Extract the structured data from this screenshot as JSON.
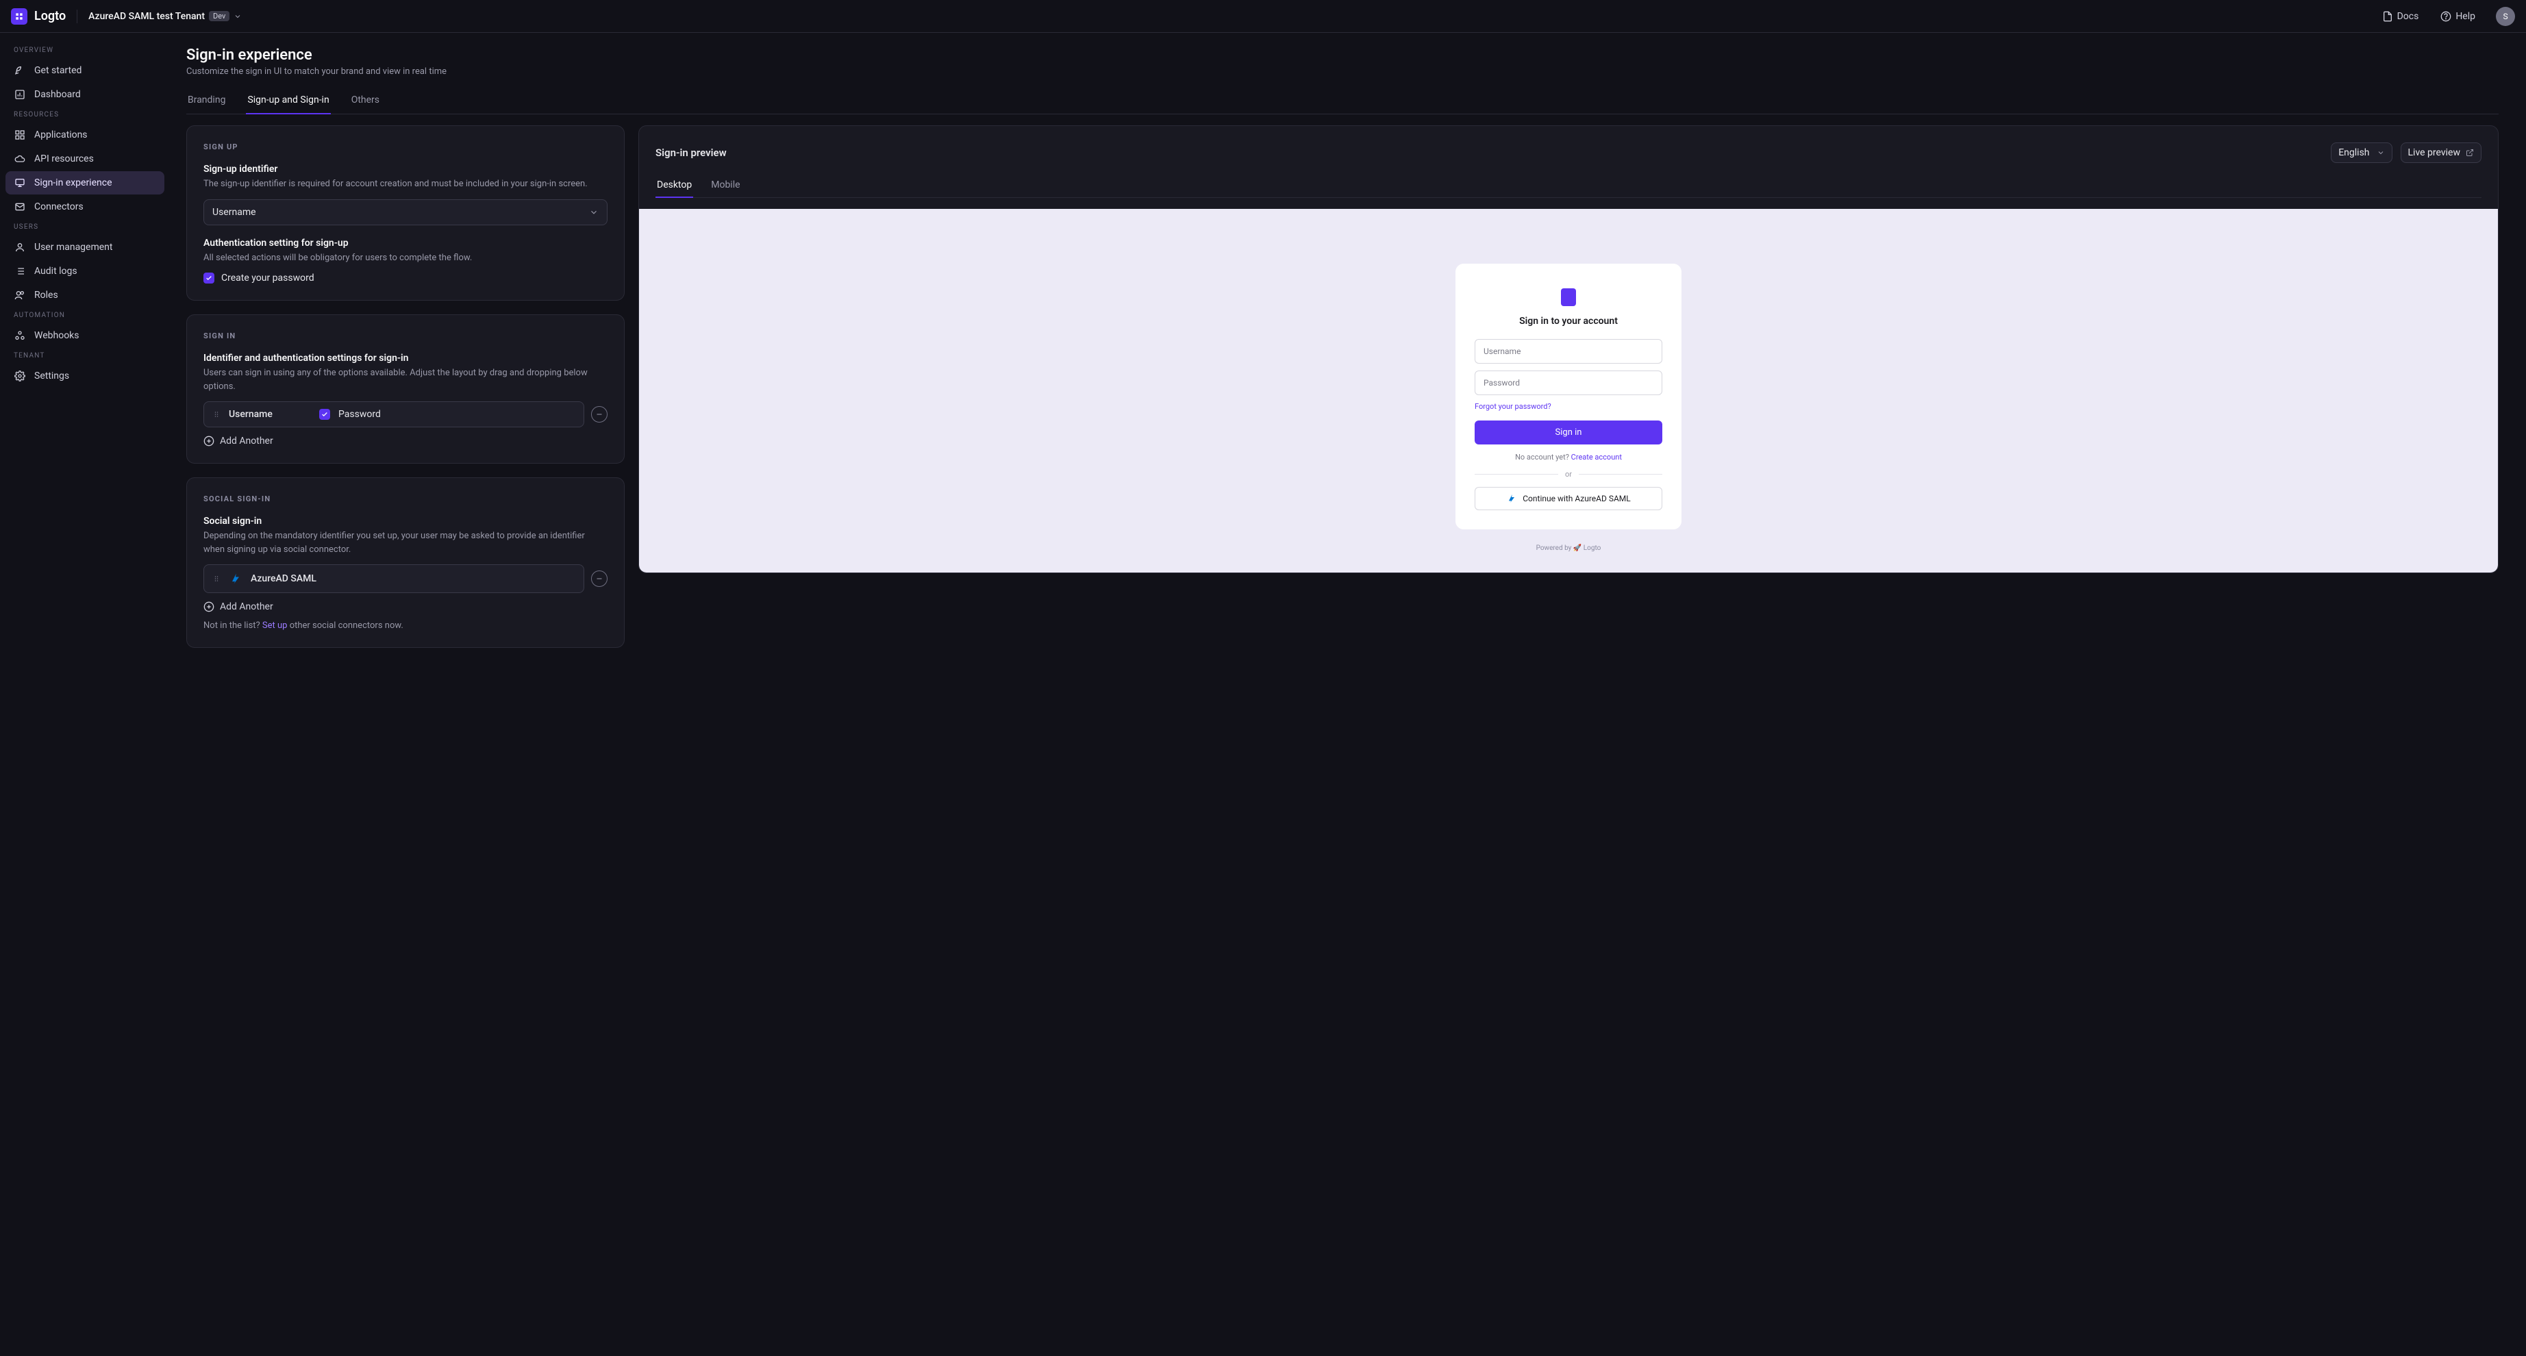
{
  "brand": {
    "name": "Logto"
  },
  "tenant": {
    "name": "AzureAD SAML test Tenant",
    "badge": "Dev"
  },
  "top_links": {
    "docs": "Docs",
    "help": "Help",
    "avatar_initial": "S"
  },
  "sidebar": {
    "sections": {
      "overview": "Overview",
      "resources": "Resources",
      "users": "Users",
      "automation": "Automation",
      "tenant": "Tenant"
    },
    "items": {
      "get_started": "Get started",
      "dashboard": "Dashboard",
      "applications": "Applications",
      "api_resources": "API resources",
      "sign_in_experience": "Sign-in experience",
      "connectors": "Connectors",
      "user_management": "User management",
      "audit_logs": "Audit logs",
      "roles": "Roles",
      "webhooks": "Webhooks",
      "settings": "Settings"
    }
  },
  "page": {
    "title": "Sign-in experience",
    "subtitle": "Customize the sign in UI to match your brand and view in real time",
    "tabs": {
      "branding": "Branding",
      "signup_signin": "Sign-up and Sign-in",
      "others": "Others"
    }
  },
  "signup_card": {
    "section": "SIGN UP",
    "identifier": {
      "title": "Sign-up identifier",
      "desc": "The sign-up identifier is required for account creation and must be included in your sign-in screen.",
      "value": "Username"
    },
    "auth_setting": {
      "title": "Authentication setting for sign-up",
      "desc": "All selected actions will be obligatory for users to complete the flow.",
      "create_password_label": "Create your password",
      "create_password_checked": true
    }
  },
  "signin_card": {
    "section": "SIGN IN",
    "title": "Identifier and authentication settings for sign-in",
    "desc": "Users can sign in using any of the options available. Adjust the layout by drag and dropping below options.",
    "methods": [
      {
        "name": "Username",
        "factor": "Password",
        "factor_checked": true
      }
    ],
    "add_another": "Add Another"
  },
  "social_card": {
    "section": "SOCIAL SIGN-IN",
    "title": "Social sign-in",
    "desc": "Depending on the mandatory identifier you set up, your user may be asked to provide an identifier when signing up via social connector.",
    "connectors": [
      {
        "name": "AzureAD SAML"
      }
    ],
    "add_another": "Add Another",
    "footnote_prefix": "Not in the list? ",
    "footnote_link": "Set up",
    "footnote_suffix": " other social connectors now."
  },
  "preview": {
    "title": "Sign-in preview",
    "language": "English",
    "live_preview": "Live preview",
    "tabs": {
      "desktop": "Desktop",
      "mobile": "Mobile"
    },
    "login": {
      "heading": "Sign in to your account",
      "username_placeholder": "Username",
      "password_placeholder": "Password",
      "forgot": "Forgot your password?",
      "signin_btn": "Sign in",
      "no_account_prefix": "No account yet? ",
      "no_account_link": "Create account",
      "or": "or",
      "oauth_btn": "Continue with AzureAD SAML",
      "powered_by": "Powered by 🚀 Logto"
    }
  }
}
